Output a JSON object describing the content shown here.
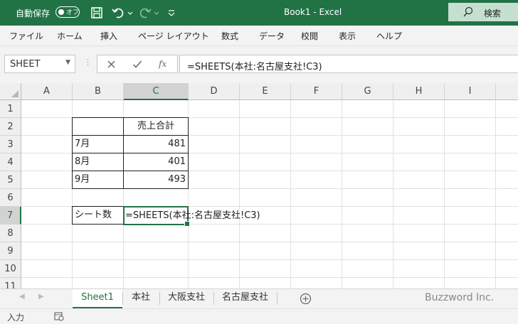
{
  "titlebar": {
    "autosave_label": "自動保存",
    "autosave_state": "オフ",
    "document_title": "Book1  -  Excel",
    "search_label": "検索"
  },
  "ribbon": {
    "tabs": [
      "ファイル",
      "ホーム",
      "挿入",
      "ページ レイアウト",
      "数式",
      "データ",
      "校閲",
      "表示",
      "ヘルプ"
    ]
  },
  "formula_bar": {
    "name_box": "SHEET",
    "fx_label": "fx",
    "formula": "=SHEETS(本社:名古屋支社!C3)"
  },
  "grid": {
    "columns": [
      "A",
      "B",
      "C",
      "D",
      "E",
      "F",
      "G",
      "H",
      "I"
    ],
    "selected_column": "C",
    "rows": [
      "1",
      "2",
      "3",
      "4",
      "5",
      "6",
      "7",
      "8",
      "9",
      "10",
      "11"
    ],
    "selected_row": "7",
    "cells": {
      "C2": "売上合計",
      "B3": "7月",
      "C3": "481",
      "B4": "8月",
      "C4": "401",
      "B5": "9月",
      "C5": "493",
      "B7": "シート数",
      "C7": "=SHEETS(本社:名古屋支社!C3)"
    }
  },
  "sheet_tabs": {
    "tabs": [
      "Sheet1",
      "本社",
      "大阪支社",
      "名古屋支社"
    ],
    "active": "Sheet1",
    "watermark": "Buzzword Inc."
  },
  "status_bar": {
    "mode": "入力"
  },
  "colors": {
    "accent": "#217346",
    "header_bg": "#efefef"
  }
}
